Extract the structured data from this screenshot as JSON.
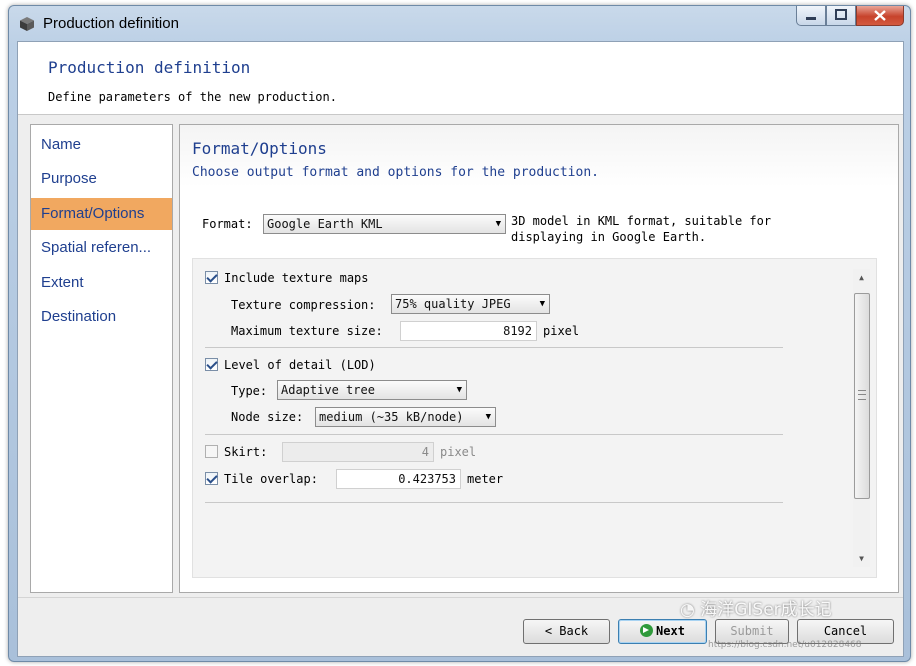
{
  "window": {
    "title": "Production definition",
    "icon": "3d-cube-app-icon"
  },
  "header": {
    "title": "Production definition",
    "subtitle": "Define parameters of the new production."
  },
  "nav": {
    "items": [
      {
        "label": "Name"
      },
      {
        "label": "Purpose"
      },
      {
        "label": "Format/Options",
        "active": true
      },
      {
        "label": "Spatial referen..."
      },
      {
        "label": "Extent"
      },
      {
        "label": "Destination"
      }
    ],
    "active_color": "#f1a860"
  },
  "page": {
    "title": "Format/Options",
    "subtitle": "Choose output format and options for the production."
  },
  "format": {
    "label": "Format:",
    "value": "Google Earth KML",
    "description_line1": "3D model in KML format, suitable for",
    "description_line2": "displaying in Google Earth."
  },
  "options": {
    "texture": {
      "checked": true,
      "label": "Include texture maps",
      "compression_label": "Texture compression:",
      "compression_value": "75% quality JPEG",
      "max_size_label": "Maximum texture size:",
      "max_size_value": "8192",
      "max_size_unit": "pixel"
    },
    "lod": {
      "checked": true,
      "label": "Level of detail (LOD)",
      "type_label": "Type:",
      "type_value": "Adaptive tree",
      "node_size_label": "Node size:",
      "node_size_value": "medium (~35 kB/node)"
    },
    "skirt": {
      "checked": false,
      "enabled": false,
      "label": "Skirt:",
      "value": "4",
      "unit": "pixel"
    },
    "tile_overlap": {
      "checked": true,
      "label": "Tile overlap:",
      "value": "0.423753",
      "unit": "meter"
    }
  },
  "buttons": {
    "back": "< Back",
    "next": "Next",
    "submit": "Submit",
    "cancel": "Cancel"
  },
  "watermark": {
    "text": "海洋GISer成长记",
    "url": "https://blog.csdn.net/u012828468"
  }
}
